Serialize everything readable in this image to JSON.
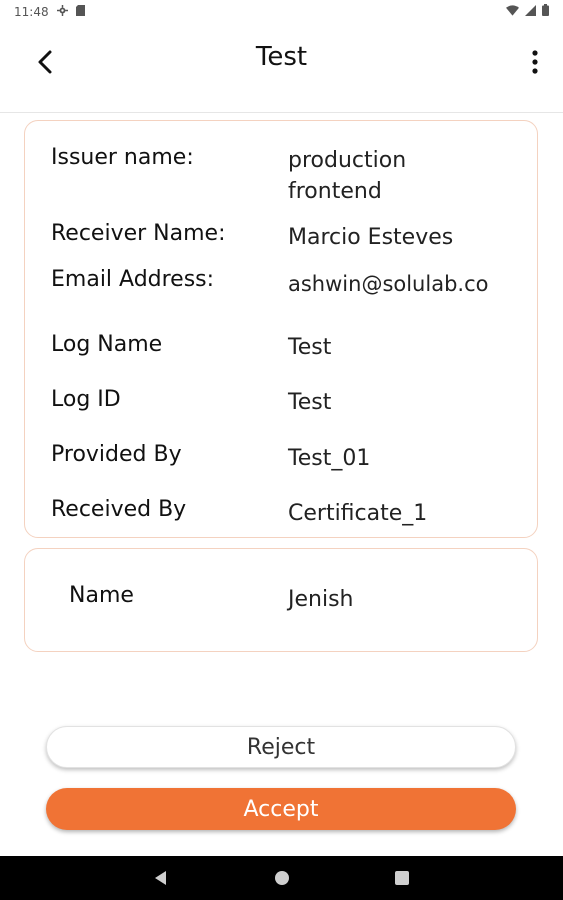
{
  "status_bar": {
    "time": "11:48"
  },
  "header": {
    "title": "Test"
  },
  "details": {
    "issuer_label": "Issuer name:",
    "issuer_value_line1": "production",
    "issuer_value_line2": "frontend",
    "receiver_label": "Receiver Name:",
    "receiver_value": "Marcio Esteves",
    "email_label": "Email Address:",
    "email_value": "ashwin@solulab.co",
    "log_name_label": "Log Name",
    "log_name_value": "Test",
    "log_id_label": "Log ID",
    "log_id_value": "Test",
    "provided_by_label": "Provided By",
    "provided_by_value": "Test_01",
    "received_by_label": "Received By",
    "received_by_value": "Certificate_1"
  },
  "extra": {
    "name_label": "Name",
    "name_value": "Jenish"
  },
  "actions": {
    "reject_label": "Reject",
    "accept_label": "Accept"
  },
  "colors": {
    "accent": "#f07335",
    "card_border": "#f4d2c0"
  },
  "icons": {
    "back": "back-arrow-icon",
    "menu": "more-vert-icon",
    "nav_back": "nav-back-icon",
    "nav_home": "nav-home-icon",
    "nav_recents": "nav-recents-icon"
  }
}
